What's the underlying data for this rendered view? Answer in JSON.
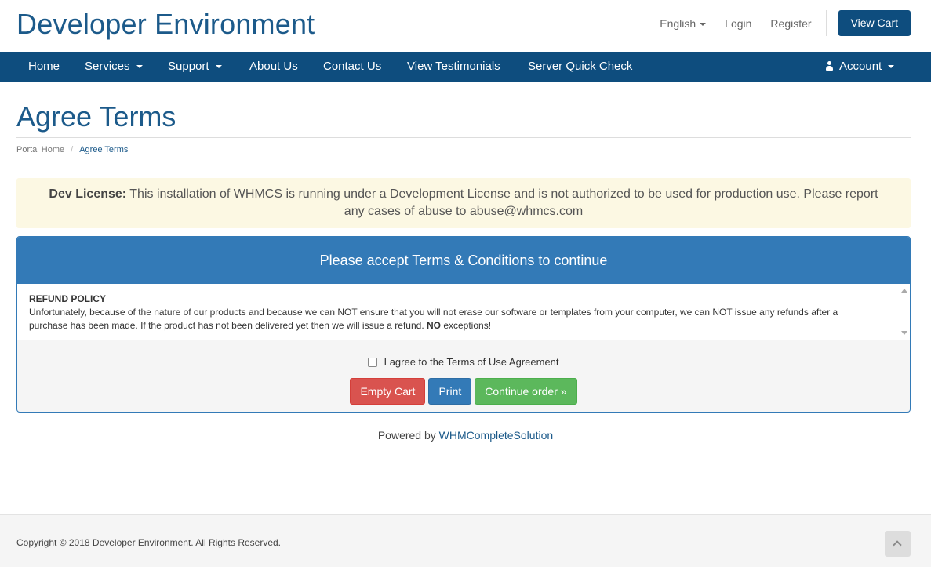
{
  "header": {
    "brand": "Developer Environment",
    "language": "English",
    "login": "Login",
    "register": "Register",
    "view_cart": "View Cart"
  },
  "nav": {
    "home": "Home",
    "services": "Services",
    "support": "Support",
    "about": "About Us",
    "contact": "Contact Us",
    "testimonials": "View Testimonials",
    "server_check": "Server Quick Check",
    "account": "Account"
  },
  "page": {
    "title": "Agree Terms",
    "breadcrumb": [
      "Portal Home",
      "Agree Terms"
    ]
  },
  "alert": {
    "label": "Dev License:",
    "text": " This installation of WHMCS is running under a Development License and is not authorized to be used for production use. Please report any cases of abuse to abuse@whmcs.com"
  },
  "panel": {
    "heading": "Please accept Terms & Conditions to continue",
    "terms_title": "REFUND POLICY",
    "terms_body": "Unfortunately, because of the nature of our products and because we can NOT ensure that you will not erase our software or templates from your computer, we can NOT issue any refunds after a purchase has been made. If the product has not been delivered yet then we will issue a refund. ",
    "terms_emphasis": "NO",
    "terms_tail": " exceptions!",
    "agree_label": "I agree to the Terms of Use Agreement",
    "agree_checked": false,
    "buttons": {
      "empty_cart": "Empty Cart",
      "print": "Print",
      "continue": "Continue order »"
    }
  },
  "powered": {
    "prefix": "Powered by ",
    "link": "WHMCompleteSolution"
  },
  "footer": {
    "copyright": "Copyright © 2018 Developer Environment. All Rights Reserved."
  },
  "colors": {
    "brand": "#0e4d7e",
    "panel": "#337ab7",
    "danger": "#d9534f",
    "success": "#5cb85c",
    "alert_bg": "#fcf8e3"
  },
  "icons": {
    "account": "user-icon",
    "back_to_top": "chevron-up-icon"
  }
}
